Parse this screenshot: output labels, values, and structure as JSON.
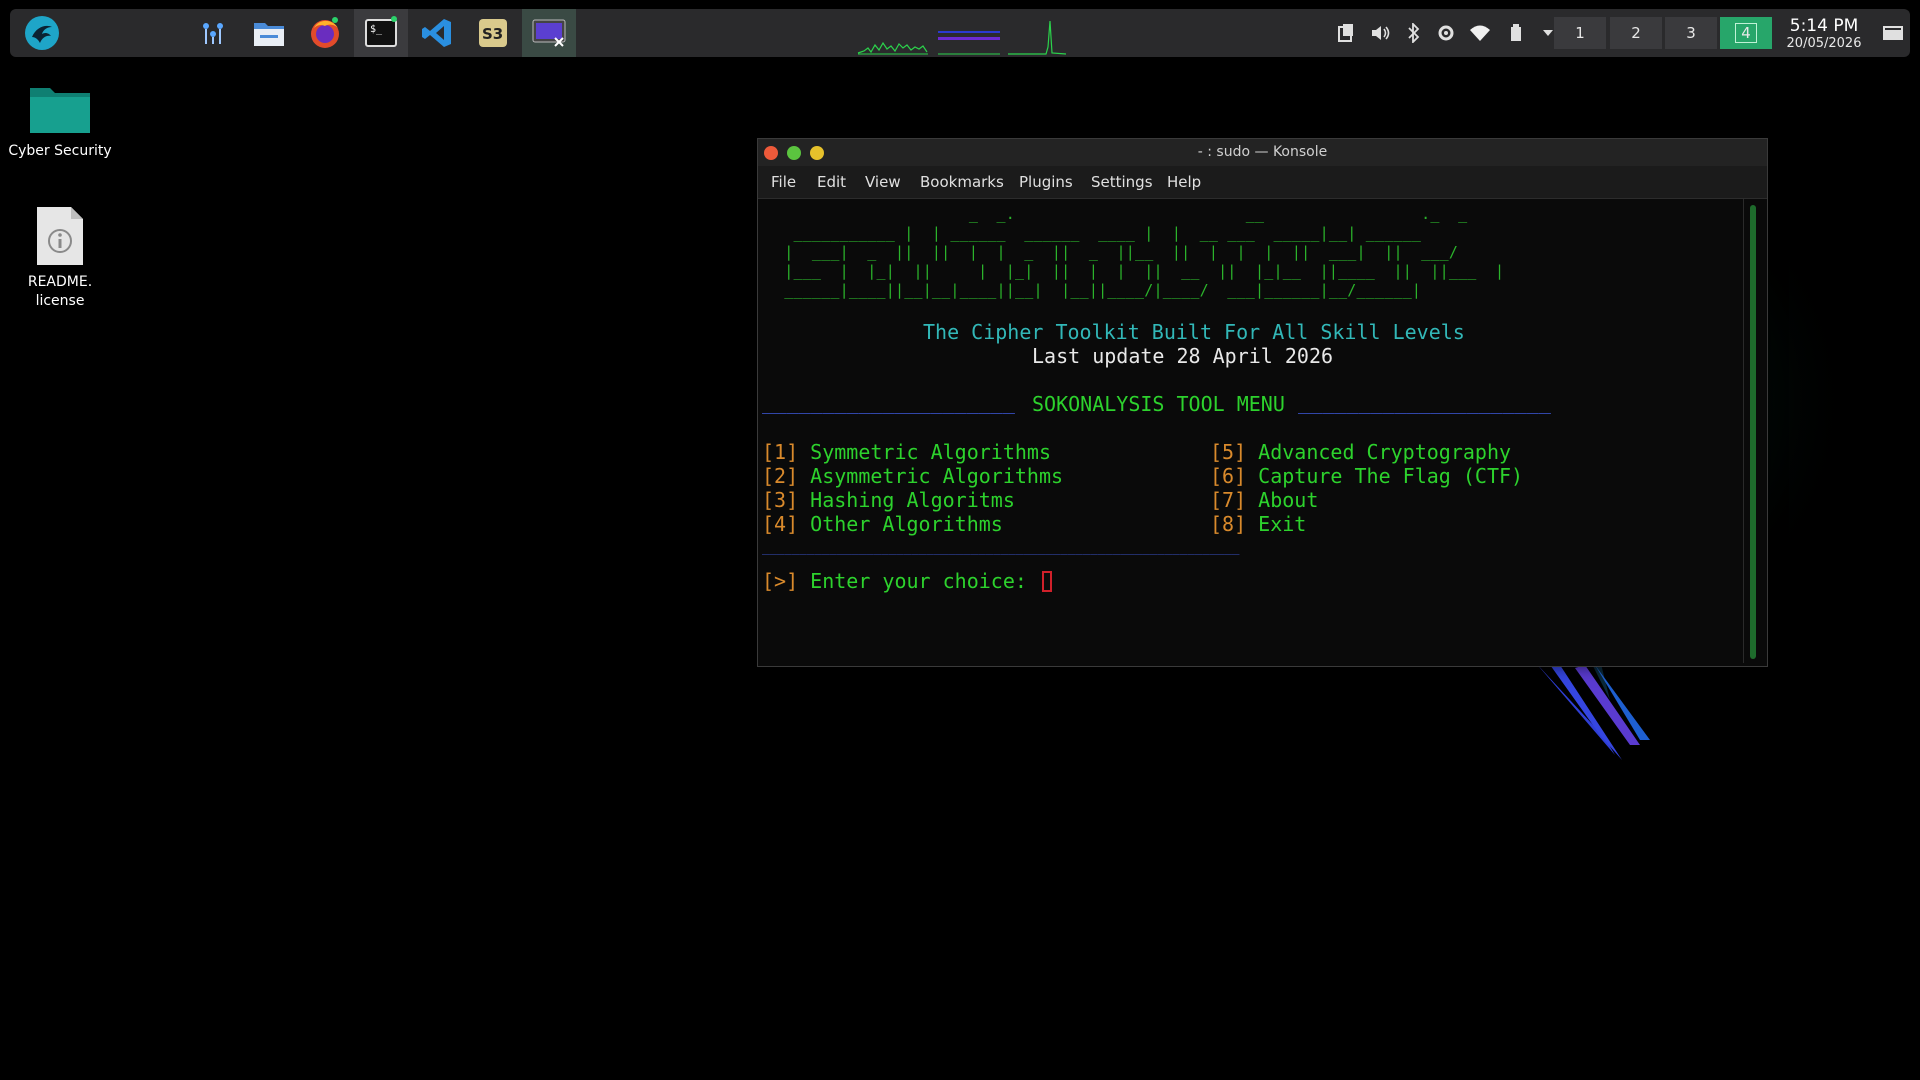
{
  "panel": {
    "launcher_icon": "kali-dragon-icon",
    "tasks": [
      {
        "name": "system-monitor-icon"
      },
      {
        "name": "file-manager-icon"
      },
      {
        "name": "firefox-icon"
      },
      {
        "name": "terminal-icon"
      },
      {
        "name": "vscode-icon"
      },
      {
        "name": "app-icon"
      },
      {
        "name": "remote-desktop-icon"
      }
    ],
    "tray_icons": [
      "clipboard-icon",
      "volume-icon",
      "bluetooth-icon",
      "settings-icon",
      "wifi-icon",
      "battery-icon",
      "chevron-down-icon"
    ],
    "virtual_desktops": [
      "1",
      "2",
      "3",
      "4"
    ],
    "current_desktop": "4",
    "clock": {
      "time": "5:14 PM",
      "date": "20/05/2026"
    }
  },
  "desktop": {
    "icons": [
      {
        "label": "Cyber Security",
        "icon": "folder-icon"
      },
      {
        "label": "README.\nlicense",
        "icon": "file-info-icon"
      }
    ]
  },
  "window": {
    "title": "- : sudo — Konsole",
    "menu": [
      "File",
      "Edit",
      "View",
      "Bookmarks",
      "Plugins",
      "Settings",
      "Help"
    ]
  },
  "terminal": {
    "banner_lines": [
      "                     _  _.                         __                 ._  _",
      "  ___________ |  | ______  ______  ____ |  |  __ ___  _____|__| ______",
      " |  ___|  _  ||  ||  |  |  _  ||  _  ||__  ||  |  |  |  ||  ___|  ||  ___/",
      " |___  |  |_|  ||     |  |_|  ||  |  |  ||  __  ||  |_|__  ||____  ||  ||___  |",
      " ______|____||__|__|____||__|  |__||____/|____/  ___|______|__/______|"
    ],
    "tagline": "The Cipher Toolkit Built For All Skill Levels",
    "update": "Last update 28 April 2026",
    "menu_rule": "_____________________",
    "menu_title": "SOKONALYSIS TOOL MENU",
    "options_left": [
      {
        "key": "[1]",
        "label": "Symmetric Algorithms"
      },
      {
        "key": "[2]",
        "label": "Asymmetric Algorithms"
      },
      {
        "key": "[3]",
        "label": "Hashing Algoritms"
      },
      {
        "key": "[4]",
        "label": "Other Algorithms"
      }
    ],
    "options_right": [
      {
        "key": "[5]",
        "label": "Advanced Cryptography"
      },
      {
        "key": "[6]",
        "label": "Capture The Flag (CTF)"
      },
      {
        "key": "[7]",
        "label": "About"
      },
      {
        "key": "[8]",
        "label": "Exit"
      }
    ],
    "bottom_rule": "________________________________________________________________",
    "prompt_marker": "[>]",
    "prompt_text": "Enter your choice:"
  },
  "colors": {
    "terminal_green": "#2dd22d",
    "terminal_orange": "#d98a2c",
    "terminal_cyan": "#32b8b8",
    "current_desktop": "#27a66a"
  }
}
